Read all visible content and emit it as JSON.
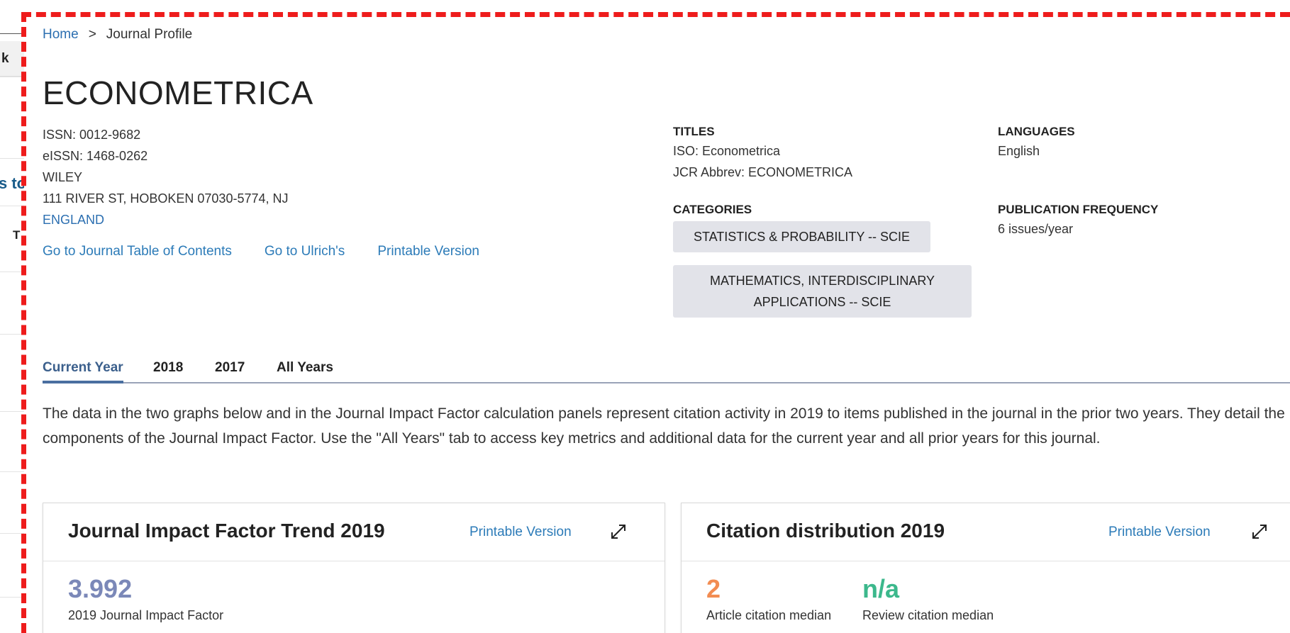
{
  "left_panel": {
    "k_text": "k",
    "st_text": "s to",
    "t_text": "T"
  },
  "breadcrumb": {
    "home": "Home",
    "separator": ">",
    "current": "Journal Profile"
  },
  "journal": {
    "title": "ECONOMETRICA",
    "issn": "ISSN: 0012-9682",
    "eissn": "eISSN: 1468-0262",
    "publisher": "WILEY",
    "address": "111 RIVER ST, HOBOKEN 07030-5774, NJ",
    "country": "ENGLAND"
  },
  "links": {
    "toc": "Go to Journal Table of Contents",
    "ulrichs": "Go to Ulrich's",
    "printable": "Printable Version"
  },
  "titles": {
    "heading": "TITLES",
    "iso": "ISO: Econometrica",
    "jcr": "JCR Abbrev: ECONOMETRICA"
  },
  "categories": {
    "heading": "CATEGORIES",
    "items": [
      "STATISTICS & PROBABILITY -- SCIE",
      "MATHEMATICS, INTERDISCIPLINARY APPLICATIONS -- SCIE"
    ]
  },
  "languages": {
    "heading": "LANGUAGES",
    "value": "English"
  },
  "frequency": {
    "heading": "PUBLICATION FREQUENCY",
    "value": "6 issues/year"
  },
  "tabs": [
    {
      "label": "Current Year",
      "active": true
    },
    {
      "label": "2018",
      "active": false
    },
    {
      "label": "2017",
      "active": false
    },
    {
      "label": "All Years",
      "active": false
    }
  ],
  "description": "The data in the two graphs below and in the Journal Impact Factor calculation panels represent citation activity in 2019 to items published in the journal in the prior two years. They detail the components of the Journal Impact Factor. Use the \"All Years\" tab to access key metrics and additional data for the current year and all prior years for this journal.",
  "jif_card": {
    "title": "Journal Impact Factor Trend 2019",
    "printable": "Printable Version",
    "value": "3.992",
    "label": "2019 Journal Impact Factor"
  },
  "citation_card": {
    "title": "Citation distribution 2019",
    "printable": "Printable Version",
    "article_value": "2",
    "article_label": "Article citation median",
    "review_value": "n/a",
    "review_label": "Review citation median"
  },
  "colors": {
    "link": "#2c7bb8",
    "highlight_dash": "#ee1c1c",
    "chip_bg": "#e2e3e9",
    "jif_value": "#7b88b8",
    "article_value": "#f28c52",
    "review_value": "#3cb88c",
    "tab_active": "#3b5f8c"
  },
  "icons": {
    "expand": "expand-diagonal-icon"
  }
}
